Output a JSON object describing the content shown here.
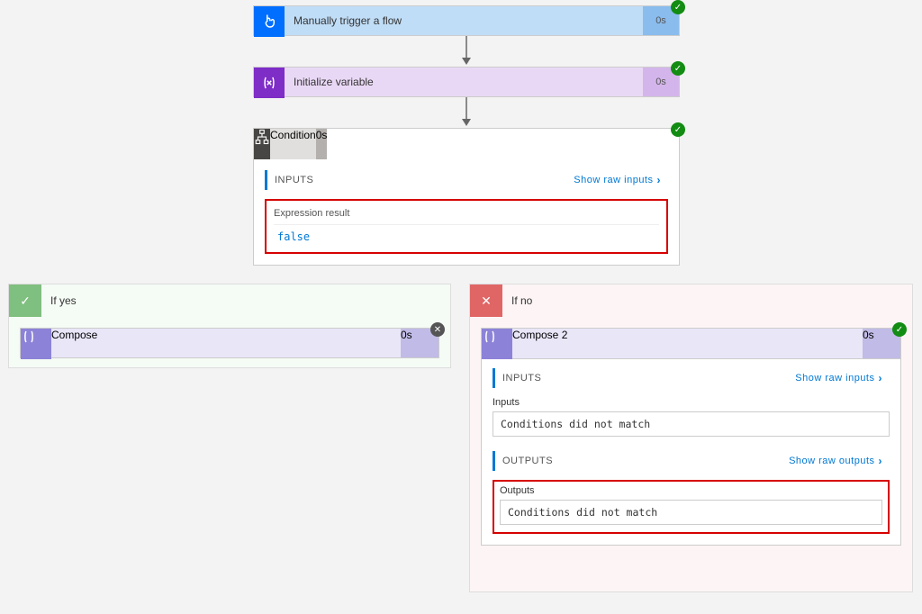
{
  "steps": {
    "trigger": {
      "label": "Manually trigger a flow",
      "duration": "0s"
    },
    "initVar": {
      "label": "Initialize variable",
      "duration": "0s"
    },
    "condition": {
      "label": "Condition",
      "duration": "0s"
    }
  },
  "condition_inputs": {
    "section_label": "INPUTS",
    "show_raw": "Show raw inputs",
    "expr_label": "Expression result",
    "expr_value": "false"
  },
  "branches": {
    "yes": {
      "title": "If yes",
      "compose": {
        "label": "Compose",
        "duration": "0s"
      }
    },
    "no": {
      "title": "If no",
      "compose": {
        "label": "Compose 2",
        "duration": "0s"
      },
      "inputs_section": "INPUTS",
      "inputs_show_raw": "Show raw inputs",
      "inputs_label": "Inputs",
      "inputs_value": "Conditions did not match",
      "outputs_section": "OUTPUTS",
      "outputs_show_raw": "Show raw outputs",
      "outputs_label": "Outputs",
      "outputs_value": "Conditions did not match"
    }
  }
}
